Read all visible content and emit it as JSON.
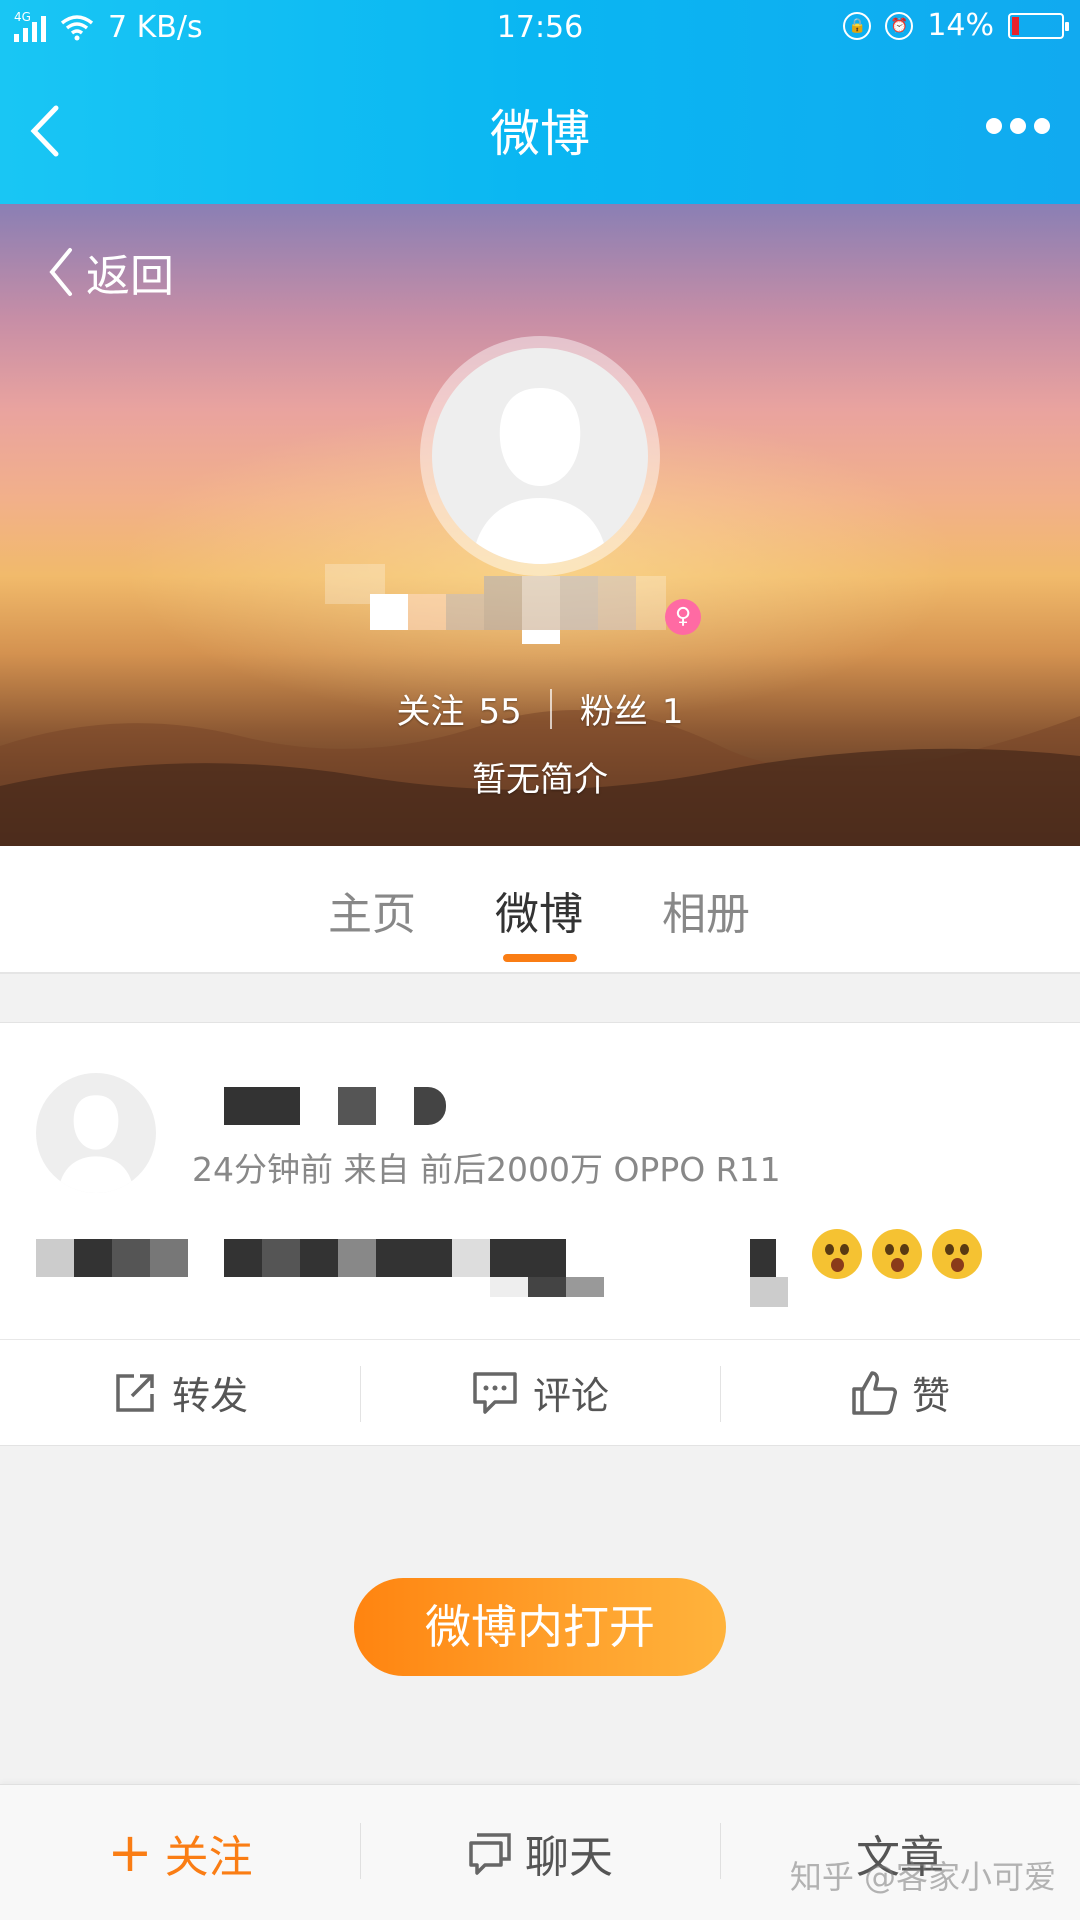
{
  "status_bar": {
    "network": "4G",
    "speed": "7 KB/s",
    "time": "17:56",
    "battery": "14%"
  },
  "header": {
    "title": "微博",
    "back_icon": "chevron-left-icon",
    "more_icon": "more-dots-icon"
  },
  "profile": {
    "back_label": "返回",
    "following_label": "关注",
    "following_count": "55",
    "followers_label": "粉丝",
    "followers_count": "1",
    "bio": "暂无简介"
  },
  "tabs": [
    {
      "label": "主页",
      "active": false
    },
    {
      "label": "微博",
      "active": true
    },
    {
      "label": "相册",
      "active": false
    }
  ],
  "post": {
    "meta": "24分钟前 来自 前后2000万 OPPO R11",
    "actions": {
      "repost": "转发",
      "comment": "评论",
      "like": "赞"
    }
  },
  "open_button": "微博内打开",
  "bottom_bar": {
    "follow": "关注",
    "chat": "聊天",
    "article": "文章"
  },
  "watermark": "知乎 @客家小可爱",
  "colors": {
    "header_blue": "#0ab6f2",
    "accent_orange": "#fa7d14",
    "battery_low": "#e8232b"
  }
}
